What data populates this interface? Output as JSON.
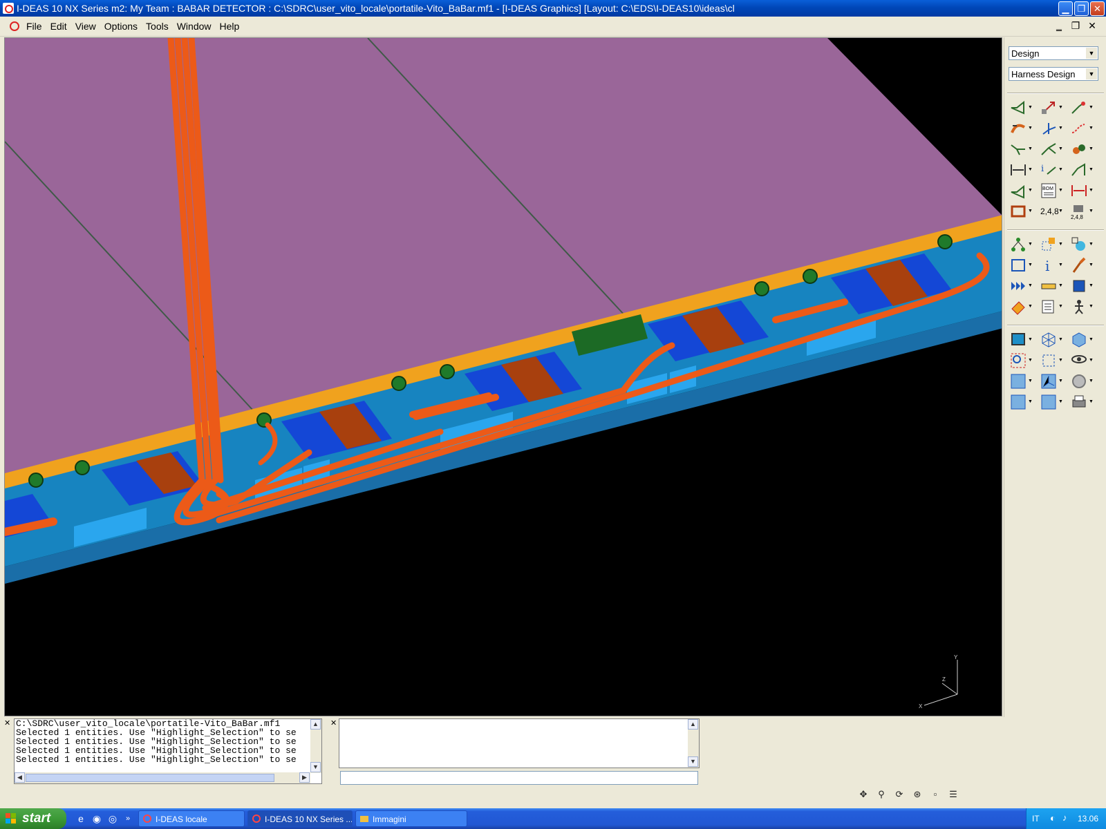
{
  "window": {
    "title": "I-DEAS 10 NX Series m2:    My Team : BABAR DETECTOR : C:\\SDRC\\user_vito_locale\\portatile-Vito_BaBar.mf1 - [I-DEAS Graphics]   [Layout: C:\\EDS\\I-DEAS10\\ideas\\cl",
    "minimize": "▁",
    "maximize": "❐",
    "close": "✕"
  },
  "menu": {
    "items": [
      "File",
      "Edit",
      "View",
      "Options",
      "Tools",
      "Window",
      "Help"
    ],
    "mdi_minimize": "‗",
    "mdi_restore": "❐",
    "mdi_close": "✕"
  },
  "panel": {
    "application": "Design",
    "task": "Harness Design",
    "label_248a": "2,4,8",
    "label_248b": "2,4,8",
    "label_bom": "BOM"
  },
  "list_window": {
    "lines": [
      "C:\\SDRC\\user_vito_locale\\portatile-Vito_BaBar.mf1",
      "Selected 1 entities.  Use \"Highlight_Selection\" to se",
      "Selected 1 entities.  Use \"Highlight_Selection\" to se",
      "Selected 1 entities.  Use \"Highlight_Selection\" to se",
      "Selected 1 entities.  Use \"Highlight_Selection\" to se"
    ]
  },
  "prompt_window": {
    "text": ""
  },
  "command_input": {
    "value": ""
  },
  "triad": {
    "x": "X",
    "y": "Y",
    "z": "Z"
  },
  "taskbar": {
    "start": "start",
    "tasks": [
      "I-DEAS locale",
      "I-DEAS 10 NX Series ...",
      "Immagini"
    ],
    "lang": "IT",
    "clock": "13.06"
  },
  "colors": {
    "background": "#000000",
    "plate": "#9a6699",
    "cable": "#ec5a18",
    "connector_blue": "#1447d6",
    "light_blue": "#1e9fe8",
    "rail": "#1784c0",
    "amber": "#f0a21e",
    "nut_green": "#1f7a2a"
  }
}
